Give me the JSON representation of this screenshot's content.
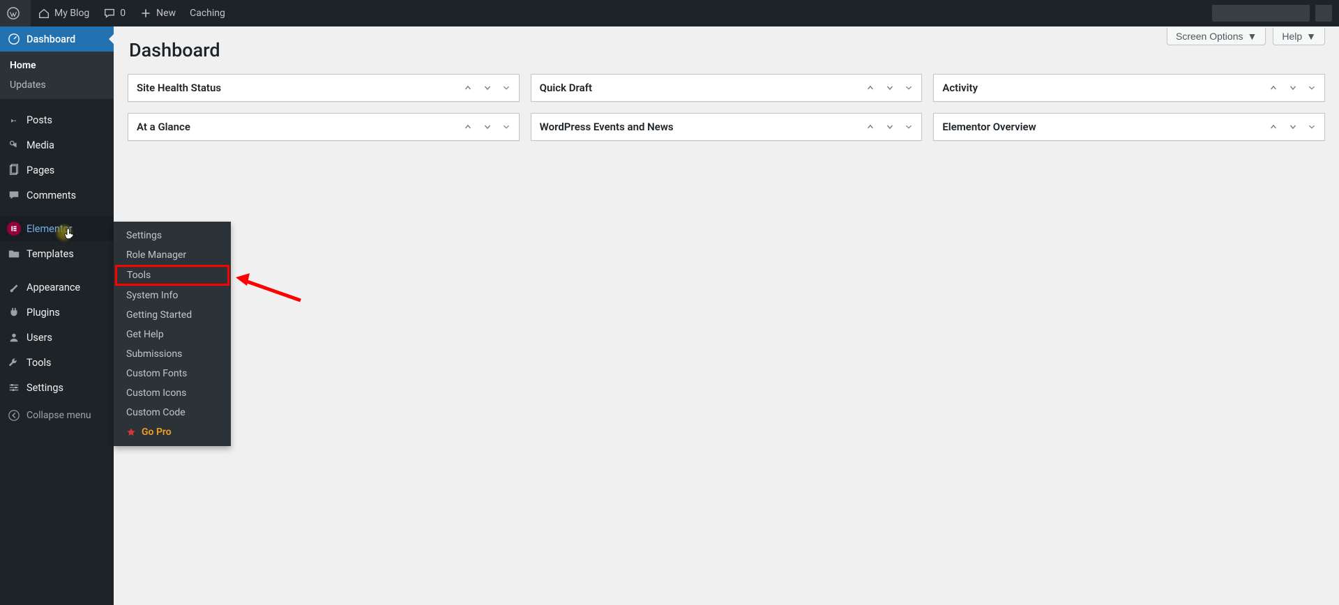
{
  "adminbar": {
    "site_name": "My Blog",
    "comments_count": "0",
    "new_label": "New",
    "caching_label": "Caching"
  },
  "sidebar": {
    "dashboard": "Dashboard",
    "home": "Home",
    "updates": "Updates",
    "posts": "Posts",
    "media": "Media",
    "pages": "Pages",
    "comments": "Comments",
    "elementor": "Elementor",
    "templates": "Templates",
    "appearance": "Appearance",
    "plugins": "Plugins",
    "users": "Users",
    "tools": "Tools",
    "settings": "Settings",
    "collapse": "Collapse menu"
  },
  "flyout": {
    "settings": "Settings",
    "role_manager": "Role Manager",
    "tools": "Tools",
    "system_info": "System Info",
    "getting_started": "Getting Started",
    "get_help": "Get Help",
    "submissions": "Submissions",
    "custom_fonts": "Custom Fonts",
    "custom_icons": "Custom Icons",
    "custom_code": "Custom Code",
    "go_pro": "Go Pro"
  },
  "header": {
    "screen_options": "Screen Options",
    "help": "Help"
  },
  "page": {
    "title": "Dashboard"
  },
  "boxes": {
    "col1": [
      {
        "title": "Site Health Status"
      },
      {
        "title": "At a Glance"
      }
    ],
    "col2": [
      {
        "title": "Quick Draft"
      },
      {
        "title": "WordPress Events and News"
      }
    ],
    "col3": [
      {
        "title": "Activity"
      },
      {
        "title": "Elementor Overview"
      }
    ]
  }
}
